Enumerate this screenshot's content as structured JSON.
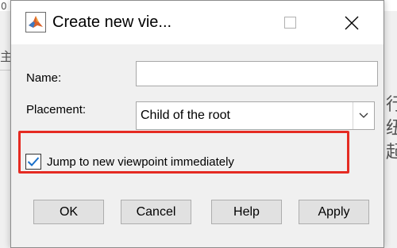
{
  "background": {
    "fragment_top": "0",
    "fragment_left": "主",
    "fragment_right": "行\n纽\n起"
  },
  "dialog": {
    "title": "Create new vie...",
    "app_icon": "matlab-icon",
    "maximize_icon": "maximize-icon",
    "close_icon": "close-icon",
    "close_glyph": "✕"
  },
  "form": {
    "name_label": "Name:",
    "name_value": "",
    "placement_label": "Placement:",
    "placement_value": "Child of the root",
    "jump_label": "Jump to new viewpoint immediately",
    "jump_checked": true
  },
  "buttons": {
    "ok": "OK",
    "cancel": "Cancel",
    "help": "Help",
    "apply": "Apply"
  },
  "colors": {
    "highlight": "#e52b22",
    "checkbox_check": "#1a6fc9"
  }
}
